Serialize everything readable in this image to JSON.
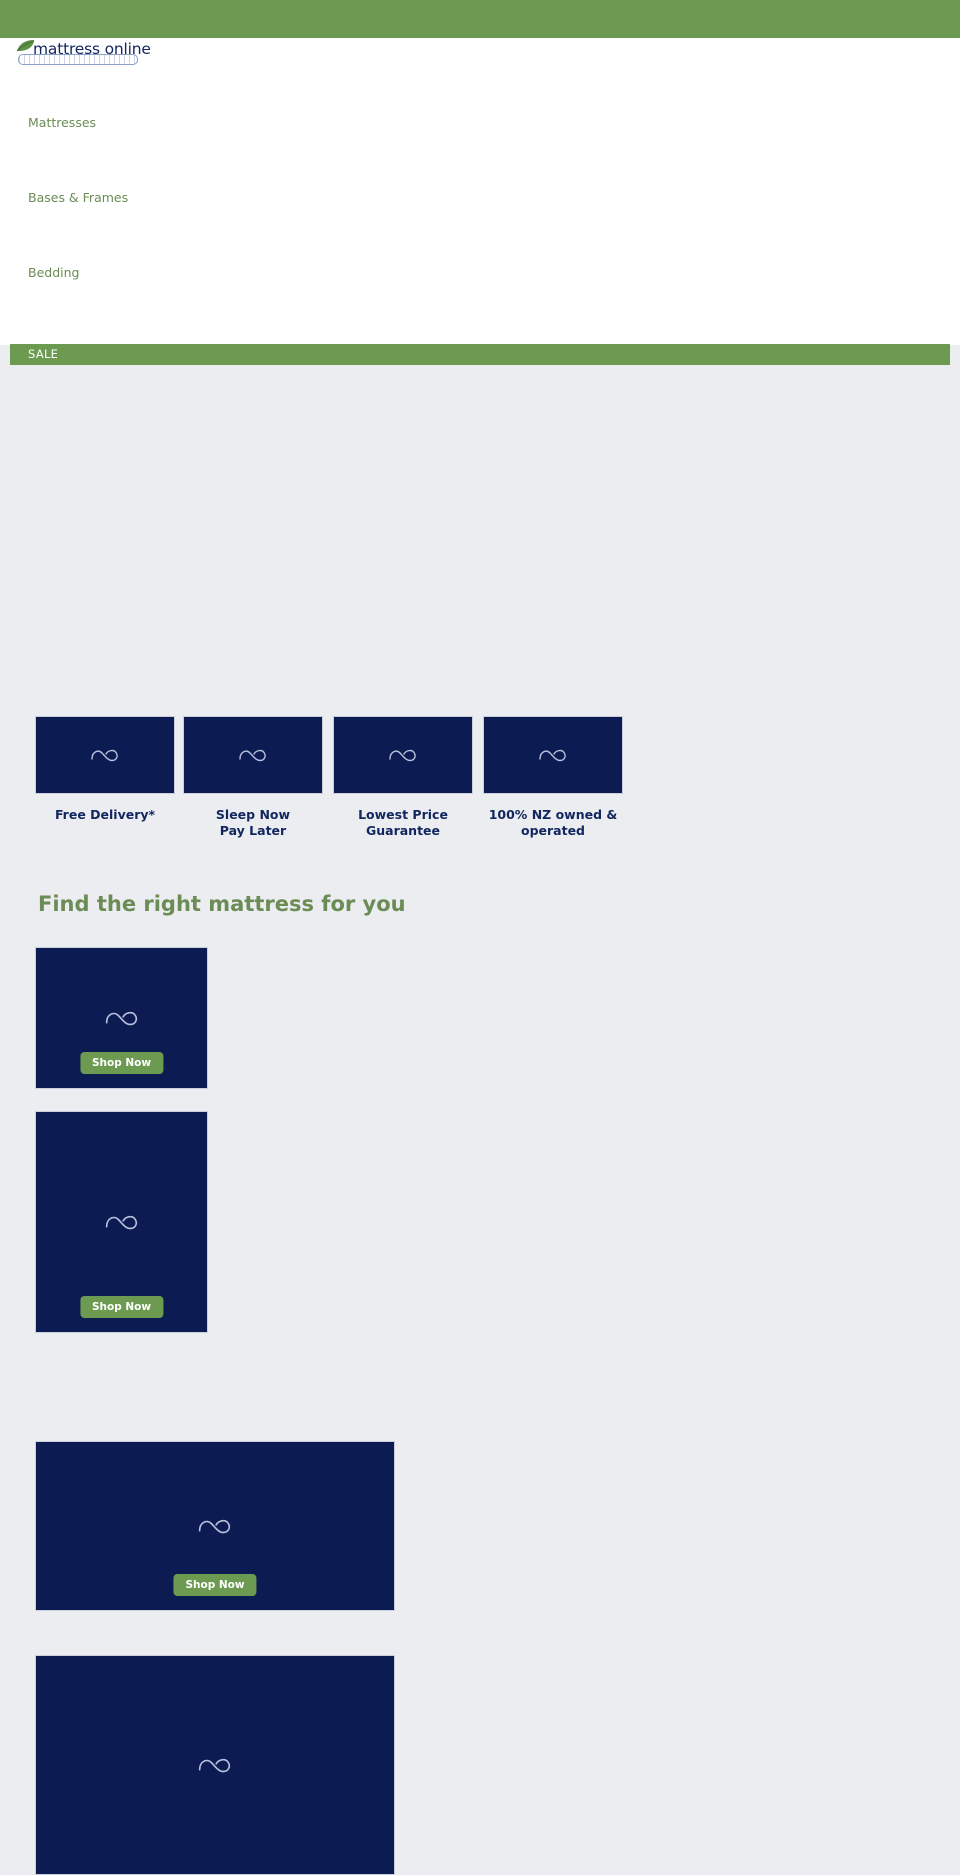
{
  "brand": {
    "colors": {
      "green": "#6b9a50",
      "nav_green": "#6b8c55",
      "navy": "#0c1c52",
      "text_navy": "#12265f",
      "page_bg": "#ebedf0",
      "white": "#ffffff"
    },
    "logo": {
      "wordmark": "mattress online",
      "leaf_icon": "leaf-icon",
      "mattress_icon": "mattress-outline-icon"
    }
  },
  "topbar": {
    "label": ""
  },
  "nav": {
    "items": [
      {
        "label": "Mattresses"
      },
      {
        "label": "Bases & Frames"
      },
      {
        "label": "Bedding"
      }
    ]
  },
  "sale_strip": {
    "label": "SALE"
  },
  "usps": [
    {
      "label": "Free Delivery*",
      "thumb_icon": "image-placeholder-icon"
    },
    {
      "label": "Sleep Now\nPay Later",
      "line1": "Sleep Now",
      "line2": "Pay Later",
      "thumb_icon": "image-placeholder-icon"
    },
    {
      "label": "Lowest Price\nGuarantee",
      "line1": "Lowest Price",
      "line2": "Guarantee",
      "thumb_icon": "image-placeholder-icon"
    },
    {
      "label": "100% NZ owned &\noperated",
      "line1": "100% NZ owned &",
      "line2": "operated",
      "thumb_icon": "image-placeholder-icon"
    }
  ],
  "section": {
    "heading": "Find the right mattress for you"
  },
  "promos": [
    {
      "cta": "Shop Now",
      "thumb_icon": "image-placeholder-icon"
    },
    {
      "cta": "Shop Now",
      "thumb_icon": "image-placeholder-icon"
    },
    {
      "cta": "Shop Now",
      "thumb_icon": "image-placeholder-icon"
    },
    {
      "cta": "",
      "thumb_icon": "image-placeholder-icon"
    }
  ]
}
